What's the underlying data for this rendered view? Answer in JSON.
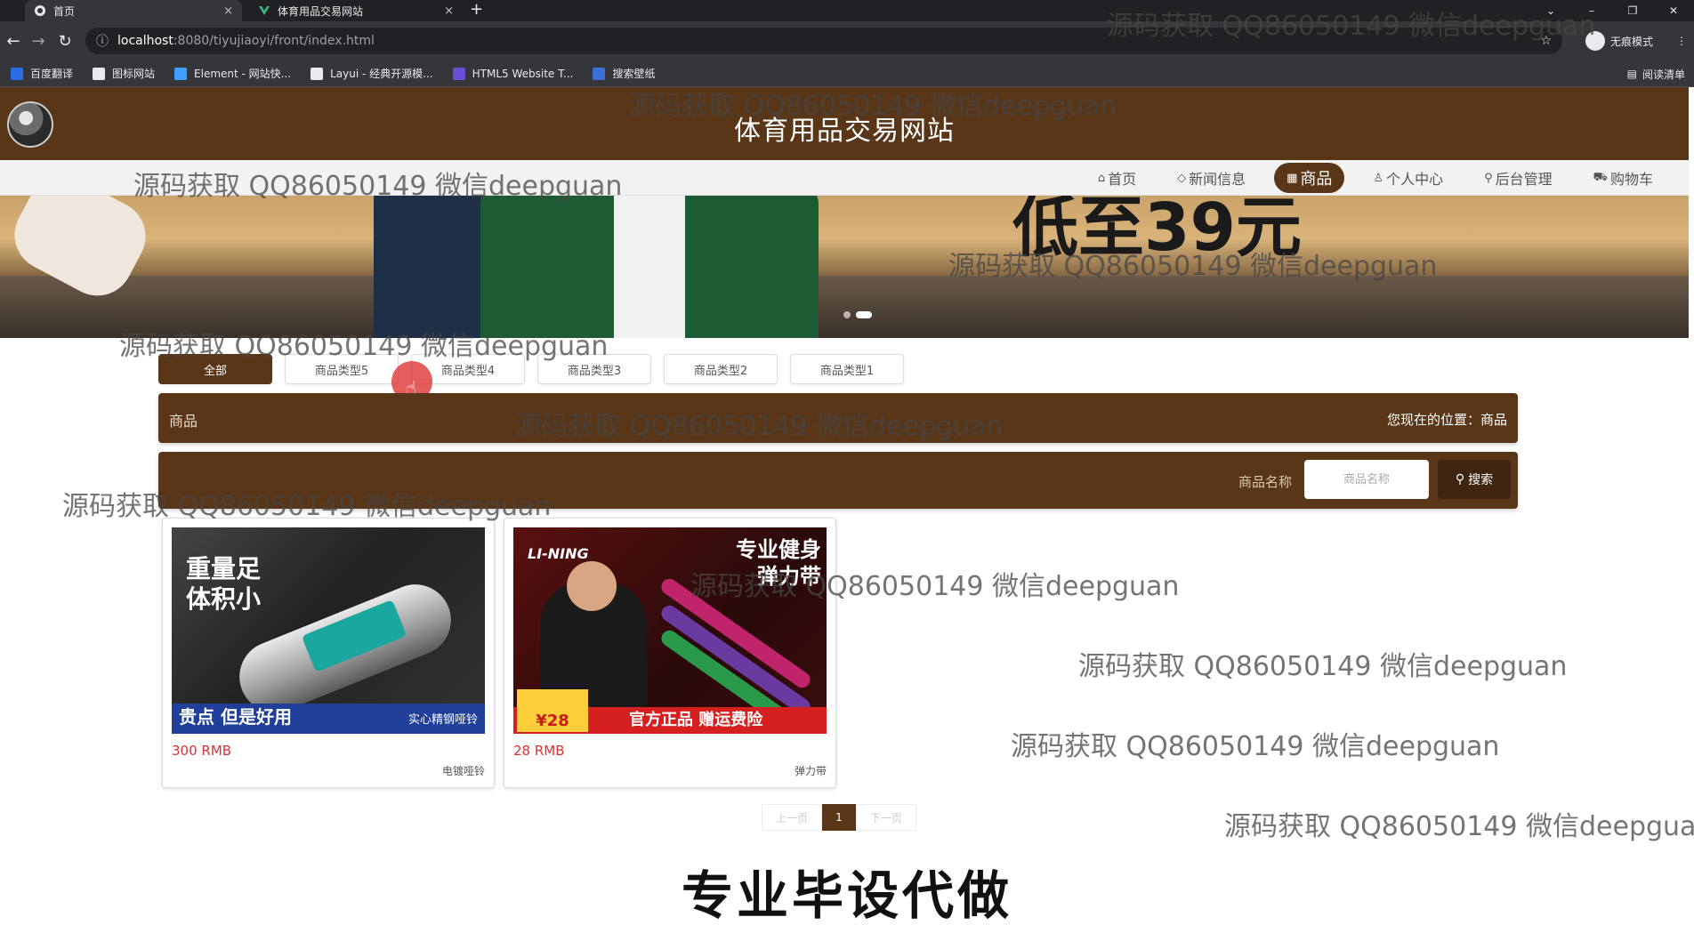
{
  "browser": {
    "tabs": [
      {
        "title": "首页",
        "close": "×"
      },
      {
        "title": "体育用品交易网站",
        "close": "×"
      }
    ],
    "new_tab": "+",
    "url_host": "localhost",
    "url_path": ":8080/tiyujiaoyi/front/index.html",
    "incognito_label": "无痕模式",
    "bookmarks": [
      {
        "label": "百度翻译",
        "color": "#2b6de5"
      },
      {
        "label": "图标网站",
        "color": "#e8eaed"
      },
      {
        "label": "Element - 网站快...",
        "color": "#409eff"
      },
      {
        "label": "Layui - 经典开源模...",
        "color": "#e8eaed"
      },
      {
        "label": "HTML5 Website T...",
        "color": "#6b4cd6"
      },
      {
        "label": "搜索壁纸",
        "color": "#3a6fd8"
      }
    ],
    "reading_list": "阅读清单"
  },
  "site": {
    "title": "体育用品交易网站",
    "nav": [
      {
        "icon": "⌂",
        "label": "首页"
      },
      {
        "icon": "◇",
        "label": "新闻信息"
      },
      {
        "icon": "▦",
        "label": "商品"
      },
      {
        "icon": "♙",
        "label": "个人中心"
      },
      {
        "icon": "⚲",
        "label": "后台管理"
      },
      {
        "icon": "⛟",
        "label": "购物车"
      }
    ],
    "active_nav_index": 2
  },
  "banner": {
    "text": "低至39元"
  },
  "categories": [
    "全部",
    "商品类型5",
    "商品类型4",
    "商品类型3",
    "商品类型2",
    "商品类型1"
  ],
  "breadcrumb": {
    "left": "商品",
    "right": "您现在的位置：商品"
  },
  "search": {
    "label": "商品名称",
    "placeholder": "商品名称",
    "button": "搜索"
  },
  "products": [
    {
      "price": "300 RMB",
      "name": "电镀哑铃",
      "img_title": "重量足\n体积小",
      "img_foot": "贵点 但是好用",
      "img_foot_sub": "实心精钢哑铃"
    },
    {
      "price": "28 RMB",
      "name": "弹力带",
      "img_brand": "LI-NING",
      "img_promo": "专业健身\n弹力带",
      "img_foot": "官方正品 赠运费险",
      "img_price": "¥28"
    }
  ],
  "pagination": {
    "prev": "上一页",
    "current": "1",
    "next": "下一页"
  },
  "footer_slogan": "专业毕设代做",
  "watermark_text": "源码获取 QQ86050149 微信deepguan",
  "colors": {
    "brand_brown": "#5a3618",
    "price_red": "#d93232"
  }
}
